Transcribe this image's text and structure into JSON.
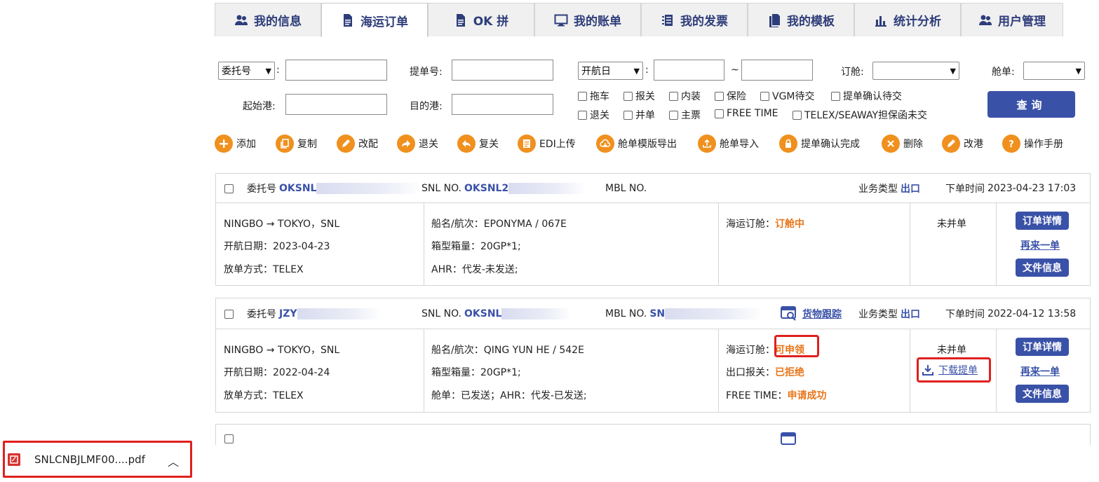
{
  "tabs": [
    {
      "label": "我的信息",
      "icon": "users-icon"
    },
    {
      "label": "海运订单",
      "icon": "document-icon",
      "active": true
    },
    {
      "label": "OK 拼",
      "icon": "document-icon"
    },
    {
      "label": "我的账单",
      "icon": "monitor-icon"
    },
    {
      "label": "我的发票",
      "icon": "list-icon"
    },
    {
      "label": "我的模板",
      "icon": "copy-icon"
    },
    {
      "label": "统计分析",
      "icon": "bar-chart-icon"
    },
    {
      "label": "用户管理",
      "icon": "users-icon"
    }
  ],
  "search": {
    "ref_select": "委托号",
    "colon": ":",
    "bl_label": "提单号:",
    "date_select": "开航日",
    "tilde": "~",
    "booking_label": "订舱:",
    "manifest_label": "舱单:",
    "origin_label": "起始港:",
    "dest_label": "目的港:",
    "checks_row1": [
      "拖车",
      "报关",
      "内装",
      "保险",
      "VGM待交",
      "提单确认待交"
    ],
    "checks_row2": [
      "退关",
      "并单",
      "主票",
      "FREE TIME",
      "TELEX/SEAWAY担保函未交"
    ],
    "query_label": "查询"
  },
  "actions": [
    {
      "label": "添加",
      "icon": "plus-icon"
    },
    {
      "label": "复制",
      "icon": "copy-icon"
    },
    {
      "label": "改配",
      "icon": "edit-icon"
    },
    {
      "label": "退关",
      "icon": "forward-icon"
    },
    {
      "label": "复关",
      "icon": "back-icon"
    },
    {
      "label": "EDI上传",
      "icon": "file-icon"
    },
    {
      "label": "舱单模版导出",
      "icon": "cloud-icon"
    },
    {
      "label": "舱单导入",
      "icon": "upload-icon"
    },
    {
      "label": "提单确认完成",
      "icon": "lock-icon"
    },
    {
      "label": "删除",
      "icon": "close-icon"
    },
    {
      "label": "改港",
      "icon": "edit-icon"
    },
    {
      "label": "操作手册",
      "icon": "help-icon"
    }
  ],
  "orders": [
    {
      "ref_label": "委托号",
      "ref_value": "OKSNL",
      "snl_label": "SNL NO.",
      "snl_value": "OKSNL2",
      "mbl_label": "MBL NO.",
      "mbl_value": "",
      "biz_label": "业务类型",
      "biz_value": "出口",
      "time_label": "下单时间",
      "time_value": "2023-04-23 17:03",
      "route": "NINGBO → TOKYO，SNL",
      "sail_date": "开航日期：2023-04-23",
      "release": "放单方式：TELEX",
      "vessel": "船名/航次：EPONYMA / 067E",
      "container": "箱型箱量：20GP*1;",
      "extra": "AHR：代发-未发送;",
      "booking_label": "海运订舱：",
      "booking_status": "订舱中",
      "merge_status": "未并单",
      "btn_detail": "订单详情",
      "btn_again": "再来一单",
      "btn_files": "文件信息"
    },
    {
      "ref_label": "委托号",
      "ref_value": "JZY",
      "snl_label": "SNL NO.",
      "snl_value": "OKSNL",
      "mbl_label": "MBL NO.",
      "mbl_value": "SN",
      "tracking_label": "货物跟踪",
      "biz_label": "业务类型",
      "biz_value": "出口",
      "time_label": "下单时间",
      "time_value": "2022-04-12 13:58",
      "route": "NINGBO → TOKYO，SNL",
      "sail_date": "开航日期：2022-04-24",
      "release": "放单方式：TELEX",
      "vessel": "船名/航次：QING YUN HE / 542E",
      "container": "箱型箱量：20GP*1;",
      "extra": "舱单：已发送；AHR：代发-已发送;",
      "booking_label": "海运订舱：",
      "booking_status": "可申领",
      "customs_label": "出口报关：",
      "customs_status": "已拒绝",
      "freetime_label": "FREE TIME：",
      "freetime_status": "申请成功",
      "merge_status": "未并单",
      "download_label": "下载提单",
      "btn_detail": "订单详情",
      "btn_again": "再来一单",
      "btn_files": "文件信息"
    }
  ],
  "download_bar": {
    "filename": "SNLCNBJLMF00....pdf",
    "icon": "pdf-icon",
    "toggle_icon": "chevron-up-icon"
  },
  "colors": {
    "brand_blue": "#3a51a8",
    "accent_orange": "#f0901e",
    "status_orange": "#e8761b",
    "highlight_red": "#e0201e"
  }
}
